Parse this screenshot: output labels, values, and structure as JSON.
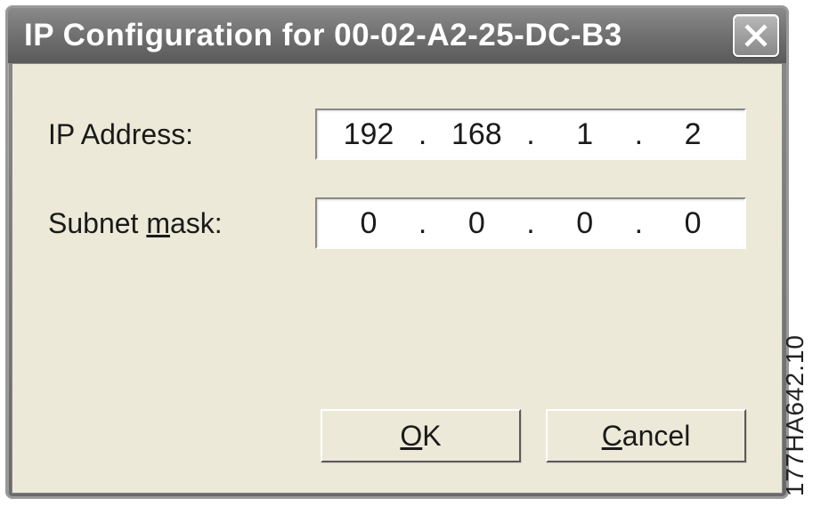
{
  "dialog": {
    "title": "IP Configuration for  00-02-A2-25-DC-B3",
    "labels": {
      "ip_address": "IP Address:",
      "subnet_mask_prefix": "Subnet ",
      "subnet_mask_mnemonic": "m",
      "subnet_mask_suffix": "ask:"
    },
    "ip_address": {
      "oct1": "192",
      "oct2": "168",
      "oct3": "1",
      "oct4": "2"
    },
    "subnet_mask": {
      "oct1": "0",
      "oct2": "0",
      "oct3": "0",
      "oct4": "0"
    },
    "buttons": {
      "ok_mnemonic": "O",
      "ok_suffix": "K",
      "cancel_mnemonic": "C",
      "cancel_suffix": "ancel"
    }
  },
  "side_label": "177HA642.10"
}
